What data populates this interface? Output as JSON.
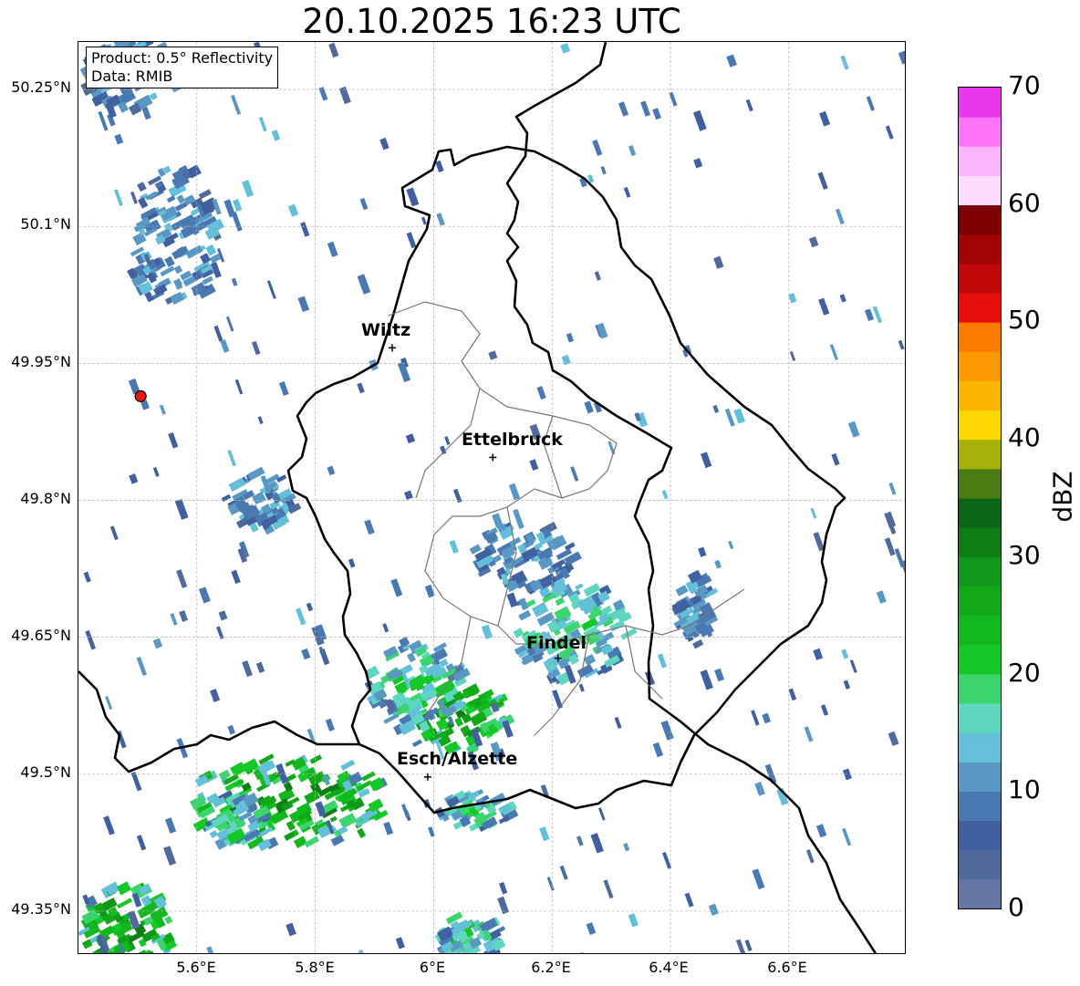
{
  "title": "20.10.2025 16:23 UTC",
  "info": {
    "product": "Product: 0.5° Reflectivity",
    "source": "Data: RMIB"
  },
  "latitude_labels": [
    "50.25°N",
    "50.1°N",
    "49.95°N",
    "49.8°N",
    "49.65°N",
    "49.5°N",
    "49.35°N"
  ],
  "longitude_labels": [
    "5.6°E",
    "5.8°E",
    "6°E",
    "6.2°E",
    "6.4°E",
    "6.6°E"
  ],
  "cities": [
    {
      "name": "Wiltz",
      "lon": 5.93,
      "lat": 49.967
    },
    {
      "name": "Ettelbruck",
      "lon": 6.1,
      "lat": 49.847
    },
    {
      "name": "Findel",
      "lon": 6.21,
      "lat": 49.627
    },
    {
      "name": "Esch/Alzette",
      "lon": 5.99,
      "lat": 49.497
    }
  ],
  "radar_site": {
    "lon": 5.505,
    "lat": 49.914,
    "color": "#e8170b"
  },
  "colorbar": {
    "label": "dBZ",
    "ticks": [
      "0",
      "10",
      "20",
      "30",
      "40",
      "50",
      "60",
      "70"
    ],
    "min": 0,
    "max": 70,
    "step": 2.5,
    "colors": [
      "#6476a4",
      "#506a9c",
      "#4060a0",
      "#4a78b0",
      "#5a98c4",
      "#64c0d8",
      "#5ed6c0",
      "#3cd46c",
      "#14c828",
      "#12b81e",
      "#12a818",
      "#10981a",
      "#0c7e14",
      "#0a6616",
      "#4a7c14",
      "#a8b00a",
      "#fcd800",
      "#fcb400",
      "#fc9800",
      "#fc7c00",
      "#e40e0a",
      "#c00808",
      "#a00404",
      "#7c0000",
      "#fcdcfc",
      "#fcb4fc",
      "#fc74f8",
      "#e838ec"
    ]
  },
  "echo_regions": [
    {
      "lon": 5.74,
      "lat": 49.47,
      "rlon": 0.17,
      "rlat": 0.05,
      "level": "strong"
    },
    {
      "lon": 5.66,
      "lat": 49.45,
      "rlon": 0.05,
      "rlat": 0.03,
      "level": "moderate"
    },
    {
      "lon": 6.02,
      "lat": 49.56,
      "rlon": 0.1,
      "rlat": 0.035,
      "level": "strong"
    },
    {
      "lon": 5.96,
      "lat": 49.6,
      "rlon": 0.08,
      "rlat": 0.05,
      "level": "moderate"
    },
    {
      "lon": 6.22,
      "lat": 49.66,
      "rlon": 0.1,
      "rlat": 0.06,
      "level": "moderate"
    },
    {
      "lon": 6.14,
      "lat": 49.74,
      "rlon": 0.09,
      "rlat": 0.035,
      "level": "weak"
    },
    {
      "lon": 6.06,
      "lat": 49.46,
      "rlon": 0.06,
      "rlat": 0.02,
      "level": "moderate"
    },
    {
      "lon": 5.47,
      "lat": 49.33,
      "rlon": 0.08,
      "rlat": 0.05,
      "level": "strong"
    },
    {
      "lon": 5.48,
      "lat": 50.27,
      "rlon": 0.09,
      "rlat": 0.04,
      "level": "weak"
    },
    {
      "lon": 5.55,
      "lat": 50.09,
      "rlon": 0.08,
      "rlat": 0.08,
      "level": "weak"
    },
    {
      "lon": 5.7,
      "lat": 49.8,
      "rlon": 0.06,
      "rlat": 0.03,
      "level": "weak"
    },
    {
      "lon": 6.05,
      "lat": 49.32,
      "rlon": 0.05,
      "rlat": 0.03,
      "level": "moderate"
    },
    {
      "lon": 6.43,
      "lat": 49.68,
      "rlon": 0.03,
      "rlat": 0.04,
      "level": "weak"
    }
  ]
}
